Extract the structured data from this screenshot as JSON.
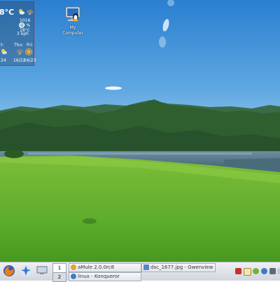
{
  "weather": {
    "temperature": "8°C",
    "humidity_pressure": "1016",
    "humidity": "60 %",
    "feels_like": "18°C",
    "wind": "3 kph",
    "forecast": [
      {
        "day": "t:",
        "icon": "partly-cloudy-icon",
        "temps": "24"
      },
      {
        "day": "Thu:",
        "icon": "storm-icon",
        "temps": "16/22"
      },
      {
        "day": "Fri:",
        "icon": "sun-icon",
        "temps": "16/23"
      }
    ]
  },
  "desktop": {
    "my_computer_label": "My Computer"
  },
  "taskbar": {
    "desktops": [
      "1",
      "2"
    ],
    "tasks": [
      {
        "label": "aMule 2.0.0rc8",
        "icon": "amule-icon"
      },
      {
        "label": "dsc_1677.jpg - Gwenview",
        "icon": "gwenview-icon"
      },
      {
        "label": "linux - Konqueror",
        "icon": "konqueror-icon"
      }
    ],
    "tray_icons": [
      "flag-icon",
      "note-icon",
      "network-icon",
      "chat-icon",
      "clock-icon",
      "monitor-icon"
    ]
  },
  "colors": {
    "sky_top": "#2a7fd0",
    "sky_bottom": "#a8cfe9",
    "field": "#5fae2c",
    "taskbar": "#e0e3e8",
    "widget_border": "#a03c3c"
  }
}
